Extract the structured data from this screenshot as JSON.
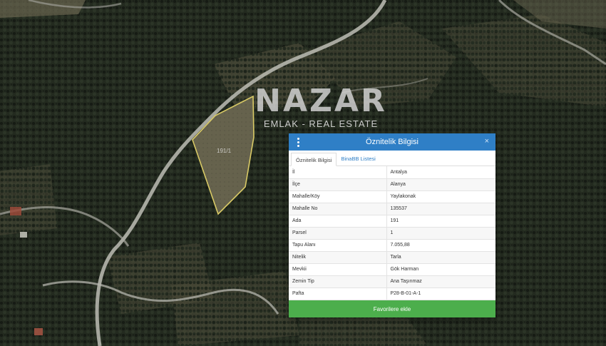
{
  "map": {
    "colors": {
      "forest_dark": "#1f251c",
      "forest_mid": "#2f3a2a",
      "field": "#5b5a43",
      "road": "#b9b9b2",
      "parcel_outline": "#e3d36a"
    },
    "parcel": {
      "label": "191/1"
    }
  },
  "watermark": {
    "logo": "NAZAR",
    "tagline": "EMLAK - REAL ESTATE"
  },
  "panel": {
    "title": "Öznitelik Bilgisi",
    "menu_icon": "vertical-dots-icon",
    "close_icon": "×",
    "tabs": [
      {
        "label": "Öznitelik Bilgisi",
        "active": true
      },
      {
        "label": "BinaBB Listesi",
        "active": false
      }
    ],
    "rows": [
      {
        "key": "İl",
        "value": "Antalya"
      },
      {
        "key": "İlçe",
        "value": "Alanya"
      },
      {
        "key": "Mahalle/Köy",
        "value": "Yaylakonak"
      },
      {
        "key": "Mahalle No",
        "value": "135537"
      },
      {
        "key": "Ada",
        "value": "191"
      },
      {
        "key": "Parsel",
        "value": "1"
      },
      {
        "key": "Tapu Alanı",
        "value": "7.055,88"
      },
      {
        "key": "Nitelik",
        "value": "Tarla"
      },
      {
        "key": "Mevkii",
        "value": "Gök Harman"
      },
      {
        "key": "Zemin Tip",
        "value": "Ana Taşınmaz"
      },
      {
        "key": "Pafta",
        "value": "P28-B-01-A-1"
      }
    ],
    "favorite_button": "Favorilere ekle",
    "colors": {
      "header": "#2f7fc6",
      "button": "#4cae4c"
    }
  }
}
